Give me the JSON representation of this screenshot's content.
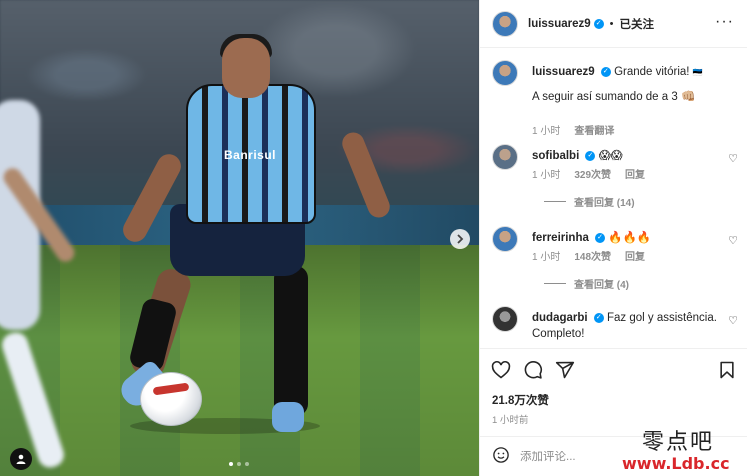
{
  "post": {
    "author": "luissuarez9",
    "follow_status": "已关注",
    "more_glyph": "···",
    "caption_line1": "Grande vitória!",
    "caption_emoji1": "🇪🇪",
    "caption_line2": "A seguir así sumando de a 3",
    "caption_emoji2": "👊🏼",
    "caption_time": "1 小时",
    "caption_translate": "查看翻译"
  },
  "comments": [
    {
      "user": "sofibalbi",
      "text": "😱😱",
      "time": "1 小时",
      "likes": "329次赞",
      "reply": "回复",
      "view_replies": "查看回复 (14)"
    },
    {
      "user": "ferreirinha",
      "text": "🔥🔥🔥",
      "time": "1 小时",
      "likes": "148次赞",
      "reply": "回复",
      "view_replies": "查看回复 (4)"
    },
    {
      "user": "dudagarbi",
      "text": "Faz gol y assistência. Completo!"
    }
  ],
  "stats": {
    "likes": "21.8万次赞",
    "posted": "1 小时前"
  },
  "comment_box": {
    "placeholder": "添加评论..."
  },
  "watermark": {
    "line1": "零点吧",
    "line2": "www.Ldb.cc"
  },
  "media": {
    "sponsor": "Banrisul",
    "carousel_count": 3,
    "carousel_active": 1
  },
  "colors": {
    "verified": "#0095f6",
    "meta_text": "#8e8e8e",
    "watermark_red": "#d9262b"
  },
  "icons": [
    "heart-icon",
    "comment-icon",
    "share-icon",
    "bookmark-icon",
    "emoji-icon",
    "chevron-right-icon",
    "tag-person-icon",
    "verified-icon",
    "more-icon"
  ]
}
